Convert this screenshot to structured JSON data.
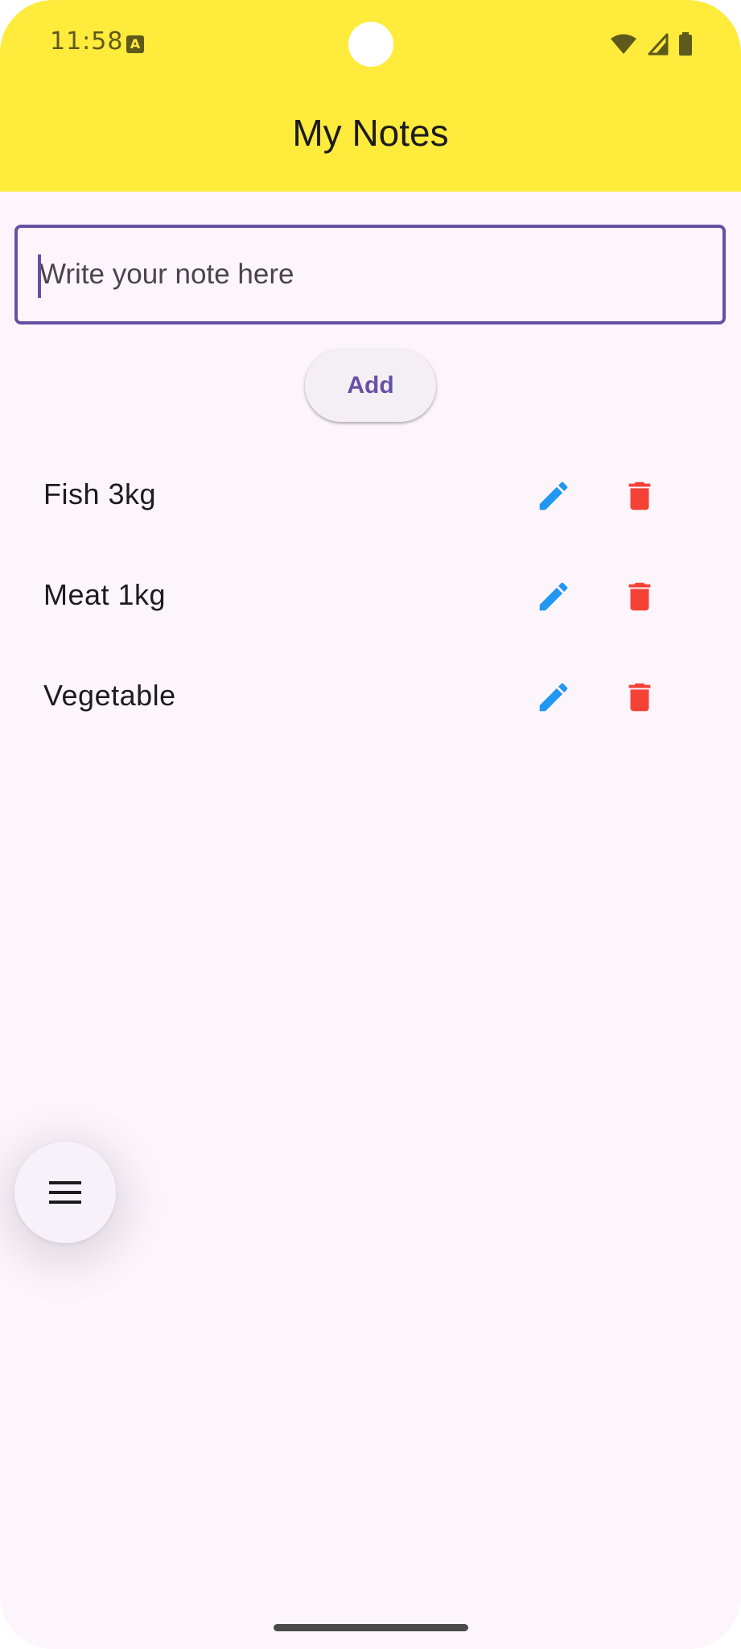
{
  "status_bar": {
    "time": "11:58",
    "notification_icon": "A"
  },
  "app_bar": {
    "title": "My Notes",
    "background_color": "#ffeb3b"
  },
  "note_input": {
    "value": "",
    "placeholder": "Write your note here",
    "focused": true
  },
  "add_button": {
    "label": "Add"
  },
  "notes": [
    {
      "text": "Fish 3kg",
      "edit_icon": "pencil-icon",
      "delete_icon": "trash-icon"
    },
    {
      "text": "Meat 1kg",
      "edit_icon": "pencil-icon",
      "delete_icon": "trash-icon"
    },
    {
      "text": "Vegetable",
      "edit_icon": "pencil-icon",
      "delete_icon": "trash-icon"
    }
  ],
  "fab": {
    "icon": "menu-icon"
  },
  "colors": {
    "accent": "#6750a4",
    "edit_icon": "#2196f3",
    "delete_icon": "#f44336",
    "background": "#fcf5fc"
  }
}
